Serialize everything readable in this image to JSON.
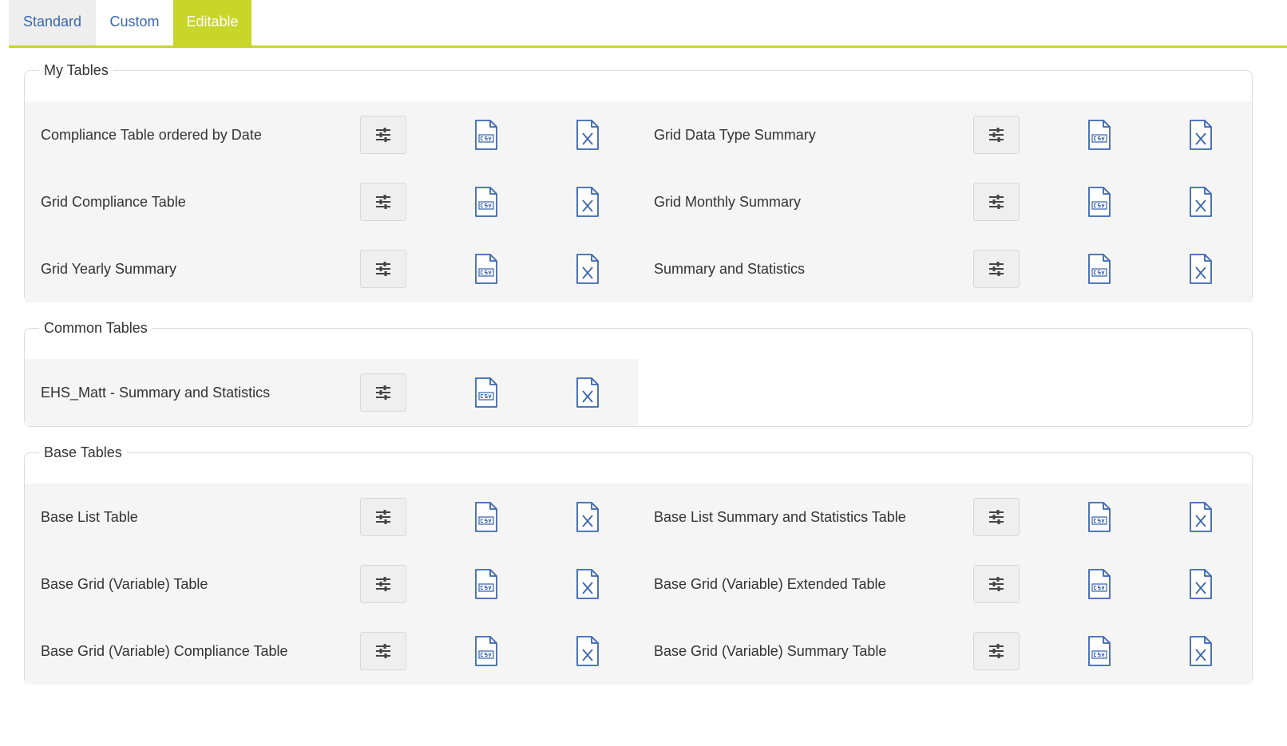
{
  "tabs": [
    {
      "label": "Standard",
      "active": false
    },
    {
      "label": "Custom",
      "active": false
    },
    {
      "label": "Editable",
      "active": true
    }
  ],
  "colors": {
    "accent": "#c8d62a",
    "link": "#3a66b0",
    "icon": "#3a66b0"
  },
  "icons": {
    "configure": "sliders-icon",
    "csv": "csv-file-icon",
    "excel": "excel-file-icon"
  },
  "groups": [
    {
      "title": "My Tables",
      "tables": [
        "Compliance Table ordered by Date",
        "Grid Data Type Summary",
        "Grid Compliance Table",
        "Grid Monthly Summary",
        "Grid Yearly Summary",
        "Summary and Statistics"
      ]
    },
    {
      "title": "Common Tables",
      "tables": [
        "EHS_Matt - Summary and Statistics"
      ]
    },
    {
      "title": "Base Tables",
      "tables": [
        "Base List Table",
        "Base List Summary and Statistics Table",
        "Base Grid (Variable) Table",
        "Base Grid (Variable) Extended Table",
        "Base Grid (Variable) Compliance Table",
        "Base Grid (Variable) Summary Table"
      ]
    }
  ]
}
